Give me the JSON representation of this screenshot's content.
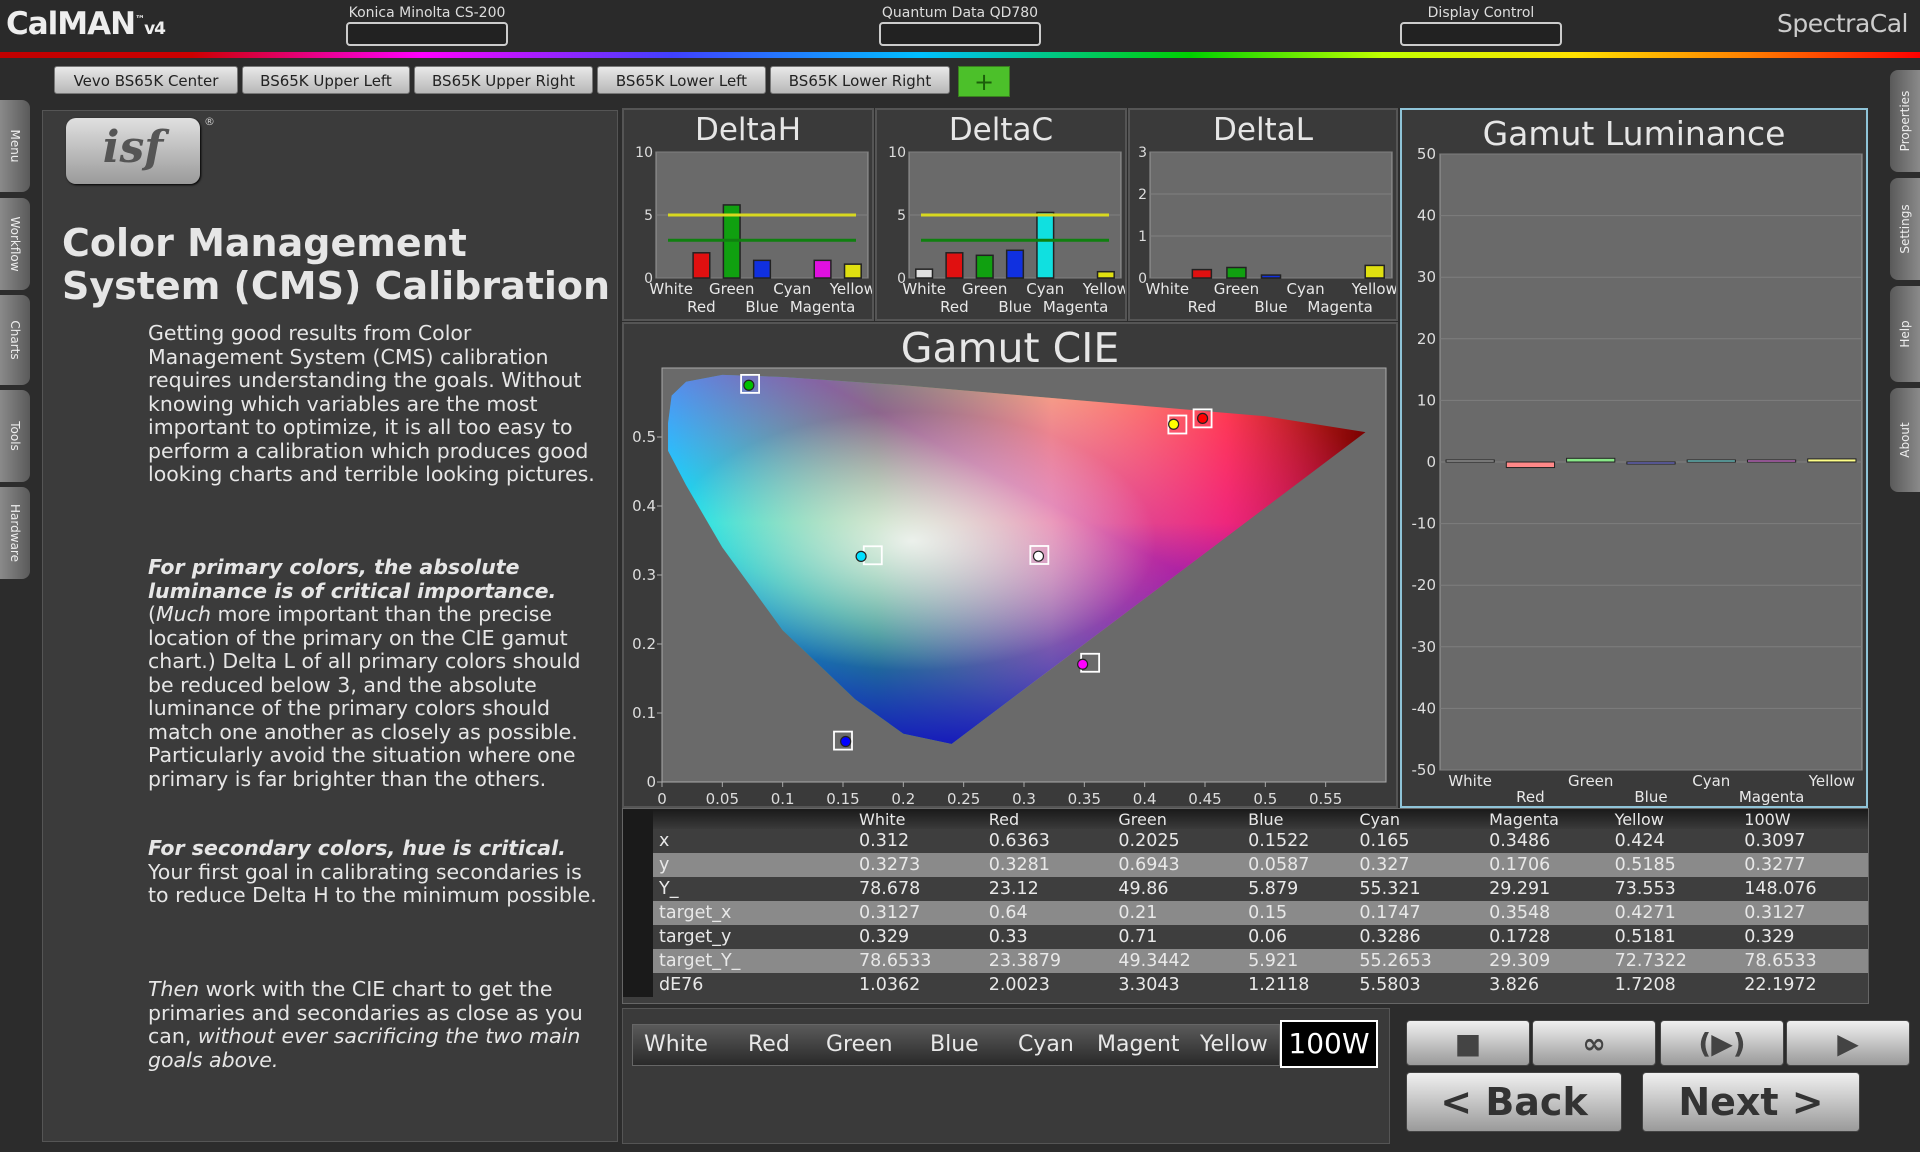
{
  "app": {
    "name": "CalMAN",
    "tm": "™",
    "version": "v4",
    "brand": "SpectraCal"
  },
  "devices": [
    "Konica Minolta CS-200",
    "Quantum Data QD780",
    "Display Control"
  ],
  "tabs": [
    "Vevo BS65K Center",
    "BS65K Upper Left",
    "BS65K Upper Right",
    "BS65K Lower Left",
    "BS65K Lower Right"
  ],
  "add_tab": "+",
  "left_side": [
    "Menu",
    "Workflow",
    "Charts",
    "Tools",
    "Hardware"
  ],
  "right_side": [
    "Properties",
    "Settings",
    "Help",
    "About"
  ],
  "logo": {
    "text": "isf",
    "reg": "®"
  },
  "page": {
    "title": "Color Management System (CMS) Calibration",
    "p1": "Getting good results from Color Management System (CMS) calibration requires understanding the goals.  Without knowing which variables are the most important to optimize, it is all too easy to perform a calibration which produces good looking charts and terrible looking pictures.",
    "p2_bold": "For primary colors, the absolute luminance is of critical importance.",
    "p2_a": "(",
    "p2_em": "Much",
    "p2_b": " more important than the precise location of the primary on the CIE gamut chart.)  Delta L of all primary colors should be reduced below 3, and the absolute luminance of the primary colors should match one another as closely as possible.  Particularly avoid the situation where one primary is far brighter than the others.",
    "p3_bold": "For secondary colors, hue is critical.",
    "p3": "Your first goal in calibrating secondaries is to reduce Delta H to the minimum possible.",
    "p4_em1": "Then",
    "p4": " work with the CIE chart to get the primaries and secondaries as close as you can, ",
    "p4_em2": "without ever sacrificing the two main goals above."
  },
  "chart_data": [
    {
      "type": "bar",
      "title": "DeltaH",
      "categories": [
        "White",
        "Red",
        "Green",
        "Blue",
        "Cyan",
        "Magenta",
        "Yellow"
      ],
      "values": [
        0,
        2,
        5.8,
        1.4,
        0,
        1.4,
        1.1
      ],
      "colors": [
        "#e0e0e0",
        "#e01010",
        "#10a010",
        "#1030e0",
        "#10e0e0",
        "#e010e0",
        "#e0e010"
      ],
      "ylim": [
        0,
        10
      ],
      "yticks": [
        0,
        5,
        10
      ],
      "ref_lines": [
        {
          "value": 5,
          "color": "#d8d820"
        },
        {
          "value": 3,
          "color": "#108010"
        }
      ]
    },
    {
      "type": "bar",
      "title": "DeltaC",
      "categories": [
        "White",
        "Red",
        "Green",
        "Blue",
        "Cyan",
        "Magenta",
        "Yellow"
      ],
      "values": [
        0.7,
        2,
        1.8,
        2.2,
        5.2,
        0,
        0.5
      ],
      "colors": [
        "#e0e0e0",
        "#e01010",
        "#10a010",
        "#1030e0",
        "#10e0e0",
        "#e010e0",
        "#e0e010"
      ],
      "ylim": [
        0,
        10
      ],
      "yticks": [
        0,
        5,
        10
      ],
      "ref_lines": [
        {
          "value": 5,
          "color": "#d8d820"
        },
        {
          "value": 3,
          "color": "#108010"
        }
      ]
    },
    {
      "type": "bar",
      "title": "DeltaL",
      "categories": [
        "White",
        "Red",
        "Green",
        "Blue",
        "Cyan",
        "Magenta",
        "Yellow"
      ],
      "values": [
        0,
        0.2,
        0.25,
        0.07,
        0,
        0,
        0.3
      ],
      "colors": [
        "#e0e0e0",
        "#e01010",
        "#10a010",
        "#1030e0",
        "#10e0e0",
        "#e010e0",
        "#e0e010"
      ],
      "ylim": [
        0,
        3
      ],
      "yticks": [
        0,
        1,
        2,
        3
      ],
      "ref_lines": []
    },
    {
      "type": "scatter",
      "title": "Gamut CIE",
      "xticks": [
        0,
        0.05,
        0.1,
        0.15,
        0.2,
        0.25,
        0.3,
        0.35,
        0.4,
        0.45,
        0.5,
        0.55
      ],
      "yticks": [
        0,
        0.1,
        0.2,
        0.3,
        0.4,
        0.5
      ],
      "xlim": [
        0,
        0.6
      ],
      "ylim": [
        0,
        0.6
      ],
      "measured": [
        {
          "name": "White",
          "x": 0.312,
          "y": 0.3273,
          "color": "#ffffff"
        },
        {
          "name": "Red",
          "x": 0.6363,
          "y": 0.3281,
          "color": "#ff0000"
        },
        {
          "name": "Green",
          "x": 0.2025,
          "y": 0.6943,
          "color": "#00c000"
        },
        {
          "name": "Blue",
          "x": 0.1522,
          "y": 0.0587,
          "color": "#0000ff"
        },
        {
          "name": "Cyan",
          "x": 0.165,
          "y": 0.327,
          "color": "#00e0ff"
        },
        {
          "name": "Magenta",
          "x": 0.3486,
          "y": 0.1706,
          "color": "#ff00ff"
        },
        {
          "name": "Yellow",
          "x": 0.424,
          "y": 0.5185,
          "color": "#ffff00"
        }
      ],
      "targets": [
        {
          "name": "White",
          "x": 0.3127,
          "y": 0.329
        },
        {
          "name": "Red",
          "x": 0.64,
          "y": 0.33
        },
        {
          "name": "Green",
          "x": 0.21,
          "y": 0.71
        },
        {
          "name": "Blue",
          "x": 0.15,
          "y": 0.06
        },
        {
          "name": "Cyan",
          "x": 0.1747,
          "y": 0.3286
        },
        {
          "name": "Magenta",
          "x": 0.3548,
          "y": 0.1728
        },
        {
          "name": "Yellow",
          "x": 0.4271,
          "y": 0.5181
        }
      ]
    },
    {
      "type": "bar",
      "title": "Gamut Luminance",
      "categories": [
        "White",
        "Red",
        "Green",
        "Blue",
        "Cyan",
        "Magenta",
        "Yellow"
      ],
      "values": [
        0,
        -0.9,
        0.6,
        -0.3,
        0,
        0,
        0.5
      ],
      "colors": [
        "#cccccc",
        "#ff8888",
        "#88e888",
        "#8888ff",
        "#88ffff",
        "#ff88ff",
        "#ffff88"
      ],
      "ylim": [
        -50,
        50
      ],
      "yticks": [
        50,
        40,
        30,
        20,
        10,
        0,
        -10,
        -20,
        -30,
        -40,
        -50
      ]
    }
  ],
  "table": {
    "headers": [
      "White",
      "Red",
      "Green",
      "Blue",
      "Cyan",
      "Magenta",
      "Yellow",
      "100W"
    ],
    "rows": [
      {
        "label": "x",
        "values": [
          "0.312",
          "0.6363",
          "0.2025",
          "0.1522",
          "0.165",
          "0.3486",
          "0.424",
          "0.3097"
        ]
      },
      {
        "label": "y",
        "values": [
          "0.3273",
          "0.3281",
          "0.6943",
          "0.0587",
          "0.327",
          "0.1706",
          "0.5185",
          "0.3277"
        ]
      },
      {
        "label": "Y_",
        "values": [
          "78.678",
          "23.12",
          "49.86",
          "5.879",
          "55.321",
          "29.291",
          "73.553",
          "148.076"
        ]
      },
      {
        "label": "target_x",
        "values": [
          "0.3127",
          "0.64",
          "0.21",
          "0.15",
          "0.1747",
          "0.3548",
          "0.4271",
          "0.3127"
        ]
      },
      {
        "label": "target_y",
        "values": [
          "0.329",
          "0.33",
          "0.71",
          "0.06",
          "0.3286",
          "0.1728",
          "0.5181",
          "0.329"
        ]
      },
      {
        "label": "target_Y_",
        "values": [
          "78.6533",
          "23.3879",
          "49.3442",
          "5.921",
          "55.2653",
          "29.309",
          "72.7322",
          "78.6533"
        ]
      },
      {
        "label": "dE76",
        "values": [
          "1.0362",
          "2.0023",
          "3.3043",
          "1.2118",
          "5.5803",
          "3.826",
          "1.7208",
          "22.1972"
        ]
      }
    ]
  },
  "selector": {
    "items": [
      "White",
      "Red",
      "Green",
      "Blue",
      "Cyan",
      "Magent",
      "Yellow"
    ],
    "active": "100W"
  },
  "controls": {
    "stop": "■",
    "loop": "∞",
    "play_step": "(▶)",
    "play": "▶",
    "back": "< Back",
    "next": "Next  >"
  }
}
